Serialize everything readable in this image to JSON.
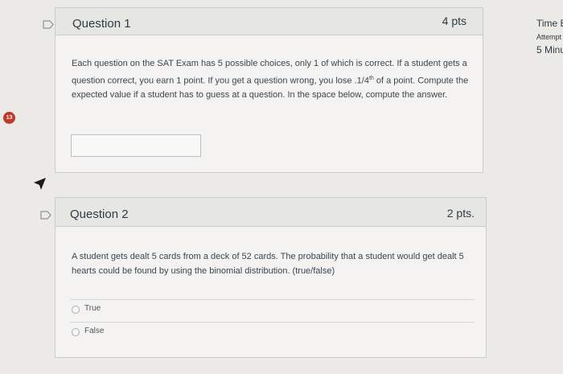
{
  "question1": {
    "title": "Question 1",
    "points": "4 pts",
    "text": "Each question on the SAT Exam has 5 possible choices, only 1 of which is correct. If a student gets a question correct, you earn 1 point.  If you get a question wrong, you lose .1/4",
    "text_sup": "th",
    "text_end": " of a point. Compute the expected value if a student has to guess at a question. In the space below, compute the answer.",
    "answer_value": ""
  },
  "question2": {
    "title": "Question 2",
    "points": "2 pts.",
    "text": "A student gets dealt 5 cards from a deck of 52 cards. The probability that a student would get dealt 5 hearts could be found by using the binomial distribution. (true/false)",
    "options": [
      {
        "label": "True"
      },
      {
        "label": "False"
      }
    ]
  },
  "sidebar": {
    "badge": "13",
    "time_label": "Time E",
    "attempt_label": "Attempt",
    "minutes_label": "5 Minu"
  },
  "colors": {
    "badge": "#c0392b",
    "card_bg": "#f4f3f1",
    "header_bg": "#e6e6e3"
  }
}
